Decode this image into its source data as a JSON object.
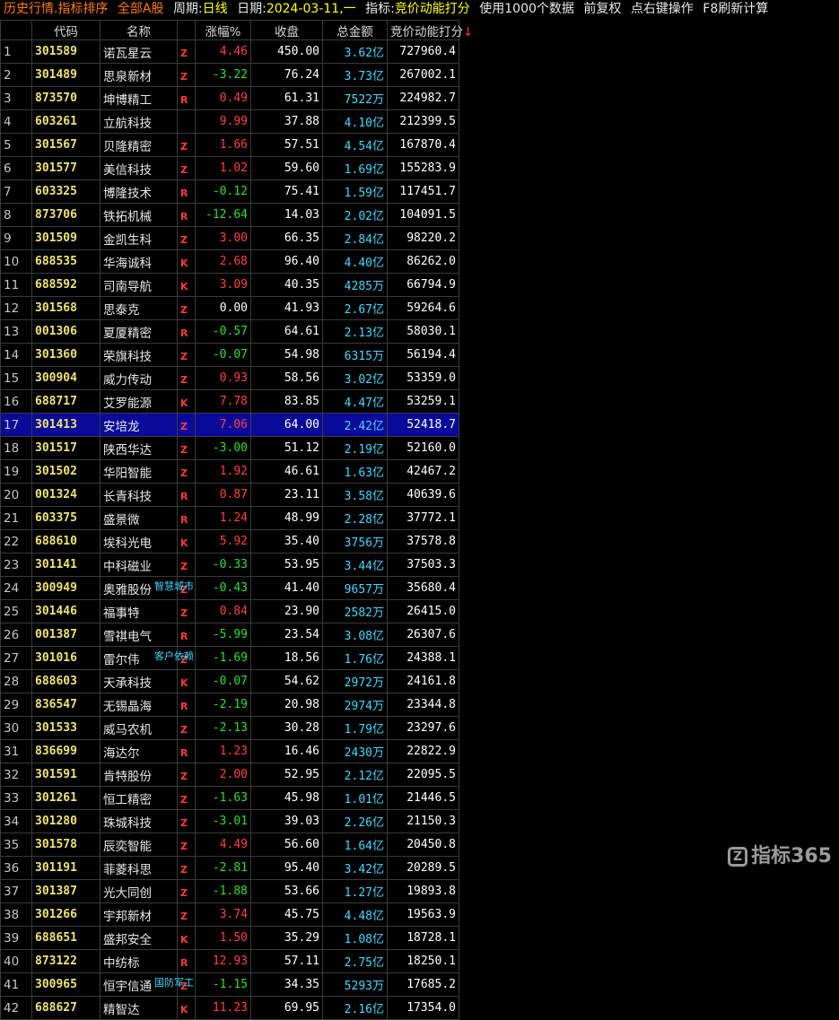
{
  "topbar": {
    "mode": "历史行情.指标排序",
    "market": "全部A股",
    "period_label": "周期:",
    "period_value": "日线",
    "date_label": "日期:",
    "date_value": "2024-03-11,一",
    "indicator_label": "指标:",
    "indicator_value": "竞价动能打分",
    "data_note": "使用1000个数据",
    "adjust": "前复权",
    "right_click": "点右键操作",
    "refresh": "F8刷新计算"
  },
  "columns": {
    "idx": "",
    "code": "代码",
    "name": "名称",
    "chg": "涨幅%",
    "close": "收盘",
    "cap": "总金额",
    "score": "竞价动能打分",
    "sort_arrow": "↓"
  },
  "rows": [
    {
      "idx": "1",
      "code": "301589",
      "name": "诺瓦星云",
      "flag": "Z",
      "chg": "4.46",
      "dir": "up",
      "close": "450.00",
      "cap": "3.62",
      "unit": "亿",
      "score": "727960.4"
    },
    {
      "idx": "2",
      "code": "301489",
      "name": "思泉新材",
      "flag": "Z",
      "chg": "-3.22",
      "dir": "down",
      "close": "76.24",
      "cap": "3.73",
      "unit": "亿",
      "score": "267002.1"
    },
    {
      "idx": "3",
      "code": "873570",
      "name": "坤博精工",
      "flag": "R",
      "chg": "0.49",
      "dir": "up",
      "close": "61.31",
      "cap": "7522",
      "unit": "万",
      "score": "224982.7"
    },
    {
      "idx": "4",
      "code": "603261",
      "name": "立航科技",
      "flag": "",
      "chg": "9.99",
      "dir": "up",
      "close": "37.88",
      "cap": "4.10",
      "unit": "亿",
      "score": "212399.5"
    },
    {
      "idx": "5",
      "code": "301567",
      "name": "贝隆精密",
      "flag": "Z",
      "chg": "1.66",
      "dir": "up",
      "close": "57.51",
      "cap": "4.54",
      "unit": "亿",
      "score": "167870.4"
    },
    {
      "idx": "6",
      "code": "301577",
      "name": "美信科技",
      "flag": "Z",
      "chg": "1.02",
      "dir": "up",
      "close": "59.60",
      "cap": "1.69",
      "unit": "亿",
      "score": "155283.9"
    },
    {
      "idx": "7",
      "code": "603325",
      "name": "博隆技术",
      "flag": "R",
      "chg": "-0.12",
      "dir": "down",
      "close": "75.41",
      "cap": "1.59",
      "unit": "亿",
      "score": "117451.7"
    },
    {
      "idx": "8",
      "code": "873706",
      "name": "铁拓机械",
      "flag": "R",
      "chg": "-12.64",
      "dir": "down",
      "close": "14.03",
      "cap": "2.02",
      "unit": "亿",
      "score": "104091.5"
    },
    {
      "idx": "9",
      "code": "301509",
      "name": "金凯生科",
      "flag": "Z",
      "chg": "3.00",
      "dir": "up",
      "close": "66.35",
      "cap": "2.84",
      "unit": "亿",
      "score": "98220.2"
    },
    {
      "idx": "10",
      "code": "688535",
      "name": "华海诚科",
      "flag": "K",
      "chg": "2.68",
      "dir": "up",
      "close": "96.40",
      "cap": "4.40",
      "unit": "亿",
      "score": "86262.0"
    },
    {
      "idx": "11",
      "code": "688592",
      "name": "司南导航",
      "flag": "K",
      "chg": "3.09",
      "dir": "up",
      "close": "40.35",
      "cap": "4285",
      "unit": "万",
      "score": "66794.9"
    },
    {
      "idx": "12",
      "code": "301568",
      "name": "思泰克",
      "flag": "Z",
      "chg": "0.00",
      "dir": "flat",
      "close": "41.93",
      "cap": "2.67",
      "unit": "亿",
      "score": "59264.6"
    },
    {
      "idx": "13",
      "code": "001306",
      "name": "夏厦精密",
      "flag": "R",
      "chg": "-0.57",
      "dir": "down",
      "close": "64.61",
      "cap": "2.13",
      "unit": "亿",
      "score": "58030.1"
    },
    {
      "idx": "14",
      "code": "301360",
      "name": "荣旗科技",
      "flag": "Z",
      "chg": "-0.07",
      "dir": "down",
      "close": "54.98",
      "cap": "6315",
      "unit": "万",
      "score": "56194.4"
    },
    {
      "idx": "15",
      "code": "300904",
      "name": "威力传动",
      "flag": "Z",
      "chg": "0.93",
      "dir": "up",
      "close": "58.56",
      "cap": "3.02",
      "unit": "亿",
      "score": "53359.0"
    },
    {
      "idx": "16",
      "code": "688717",
      "name": "艾罗能源",
      "flag": "K",
      "chg": "7.78",
      "dir": "up",
      "close": "83.85",
      "cap": "4.47",
      "unit": "亿",
      "score": "53259.1"
    },
    {
      "idx": "17",
      "code": "301413",
      "name": "安培龙",
      "flag": "Z",
      "chg": "7.06",
      "dir": "up",
      "close": "64.00",
      "cap": "2.42",
      "unit": "亿",
      "score": "52418.7",
      "selected": true
    },
    {
      "idx": "18",
      "code": "301517",
      "name": "陕西华达",
      "flag": "Z",
      "chg": "-3.00",
      "dir": "down",
      "close": "51.12",
      "cap": "2.19",
      "unit": "亿",
      "score": "52160.0"
    },
    {
      "idx": "19",
      "code": "301502",
      "name": "华阳智能",
      "flag": "Z",
      "chg": "1.92",
      "dir": "up",
      "close": "46.61",
      "cap": "1.63",
      "unit": "亿",
      "score": "42467.2"
    },
    {
      "idx": "20",
      "code": "001324",
      "name": "长青科技",
      "flag": "R",
      "chg": "0.87",
      "dir": "up",
      "close": "23.11",
      "cap": "3.58",
      "unit": "亿",
      "score": "40639.6"
    },
    {
      "idx": "21",
      "code": "603375",
      "name": "盛景微",
      "flag": "R",
      "chg": "1.24",
      "dir": "up",
      "close": "48.99",
      "cap": "2.28",
      "unit": "亿",
      "score": "37772.1"
    },
    {
      "idx": "22",
      "code": "688610",
      "name": "埃科光电",
      "flag": "K",
      "chg": "5.92",
      "dir": "up",
      "close": "35.40",
      "cap": "3756",
      "unit": "万",
      "score": "37578.8"
    },
    {
      "idx": "23",
      "code": "301141",
      "name": "中科磁业",
      "flag": "Z",
      "chg": "-0.33",
      "dir": "down",
      "close": "53.95",
      "cap": "3.44",
      "unit": "亿",
      "score": "37503.3"
    },
    {
      "idx": "24",
      "code": "300949",
      "name": "奥雅股份",
      "flag": "Z",
      "chg": "-0.43",
      "dir": "down",
      "close": "41.40",
      "cap": "9657",
      "unit": "万",
      "score": "35680.4",
      "tag": "智慧城市"
    },
    {
      "idx": "25",
      "code": "301446",
      "name": "福事特",
      "flag": "Z",
      "chg": "0.84",
      "dir": "up",
      "close": "23.90",
      "cap": "2582",
      "unit": "万",
      "score": "26415.0"
    },
    {
      "idx": "26",
      "code": "001387",
      "name": "雪祺电气",
      "flag": "R",
      "chg": "-5.99",
      "dir": "down",
      "close": "23.54",
      "cap": "3.08",
      "unit": "亿",
      "score": "26307.6"
    },
    {
      "idx": "27",
      "code": "301016",
      "name": "雷尔伟",
      "flag": "Z",
      "chg": "-1.69",
      "dir": "down",
      "close": "18.56",
      "cap": "1.76",
      "unit": "亿",
      "score": "24388.1",
      "tag": "客户依赖"
    },
    {
      "idx": "28",
      "code": "688603",
      "name": "天承科技",
      "flag": "K",
      "chg": "-0.07",
      "dir": "down",
      "close": "54.62",
      "cap": "2972",
      "unit": "万",
      "score": "24161.8"
    },
    {
      "idx": "29",
      "code": "836547",
      "name": "无锡晶海",
      "flag": "R",
      "chg": "-2.19",
      "dir": "down",
      "close": "20.98",
      "cap": "2974",
      "unit": "万",
      "score": "23344.8"
    },
    {
      "idx": "30",
      "code": "301533",
      "name": "威马农机",
      "flag": "Z",
      "chg": "-2.13",
      "dir": "down",
      "close": "30.28",
      "cap": "1.79",
      "unit": "亿",
      "score": "23297.6"
    },
    {
      "idx": "31",
      "code": "836699",
      "name": "海达尔",
      "flag": "R",
      "chg": "1.23",
      "dir": "up",
      "close": "16.46",
      "cap": "2430",
      "unit": "万",
      "score": "22822.9"
    },
    {
      "idx": "32",
      "code": "301591",
      "name": "肯特股份",
      "flag": "Z",
      "chg": "2.00",
      "dir": "up",
      "close": "52.95",
      "cap": "2.12",
      "unit": "亿",
      "score": "22095.5"
    },
    {
      "idx": "33",
      "code": "301261",
      "name": "恒工精密",
      "flag": "Z",
      "chg": "-1.63",
      "dir": "down",
      "close": "45.98",
      "cap": "1.01",
      "unit": "亿",
      "score": "21446.5"
    },
    {
      "idx": "34",
      "code": "301280",
      "name": "珠城科技",
      "flag": "Z",
      "chg": "-3.01",
      "dir": "down",
      "close": "39.03",
      "cap": "2.26",
      "unit": "亿",
      "score": "21150.3"
    },
    {
      "idx": "35",
      "code": "301578",
      "name": "辰奕智能",
      "flag": "Z",
      "chg": "4.49",
      "dir": "up",
      "close": "56.60",
      "cap": "1.64",
      "unit": "亿",
      "score": "20450.8"
    },
    {
      "idx": "36",
      "code": "301191",
      "name": "菲菱科思",
      "flag": "Z",
      "chg": "-2.81",
      "dir": "down",
      "close": "95.40",
      "cap": "3.42",
      "unit": "亿",
      "score": "20289.5"
    },
    {
      "idx": "37",
      "code": "301387",
      "name": "光大同创",
      "flag": "Z",
      "chg": "-1.88",
      "dir": "down",
      "close": "53.66",
      "cap": "1.27",
      "unit": "亿",
      "score": "19893.8"
    },
    {
      "idx": "38",
      "code": "301266",
      "name": "宇邦新材",
      "flag": "Z",
      "chg": "3.74",
      "dir": "up",
      "close": "45.75",
      "cap": "4.48",
      "unit": "亿",
      "score": "19563.9"
    },
    {
      "idx": "39",
      "code": "688651",
      "name": "盛邦安全",
      "flag": "K",
      "chg": "1.50",
      "dir": "up",
      "close": "35.29",
      "cap": "1.08",
      "unit": "亿",
      "score": "18728.1"
    },
    {
      "idx": "40",
      "code": "873122",
      "name": "中纺标",
      "flag": "R",
      "chg": "12.93",
      "dir": "up",
      "close": "57.11",
      "cap": "2.75",
      "unit": "亿",
      "score": "18250.1"
    },
    {
      "idx": "41",
      "code": "300965",
      "name": "恒宇信通",
      "flag": "Z",
      "chg": "-1.15",
      "dir": "down",
      "close": "34.35",
      "cap": "5293",
      "unit": "万",
      "score": "17685.2",
      "tag": "国防军工"
    },
    {
      "idx": "42",
      "code": "688627",
      "name": "精智达",
      "flag": "K",
      "chg": "11.23",
      "dir": "up",
      "close": "69.95",
      "cap": "2.16",
      "unit": "亿",
      "score": "17354.0"
    }
  ],
  "watermark": {
    "logo_icon": "z-logo-icon",
    "text": "指标365"
  }
}
